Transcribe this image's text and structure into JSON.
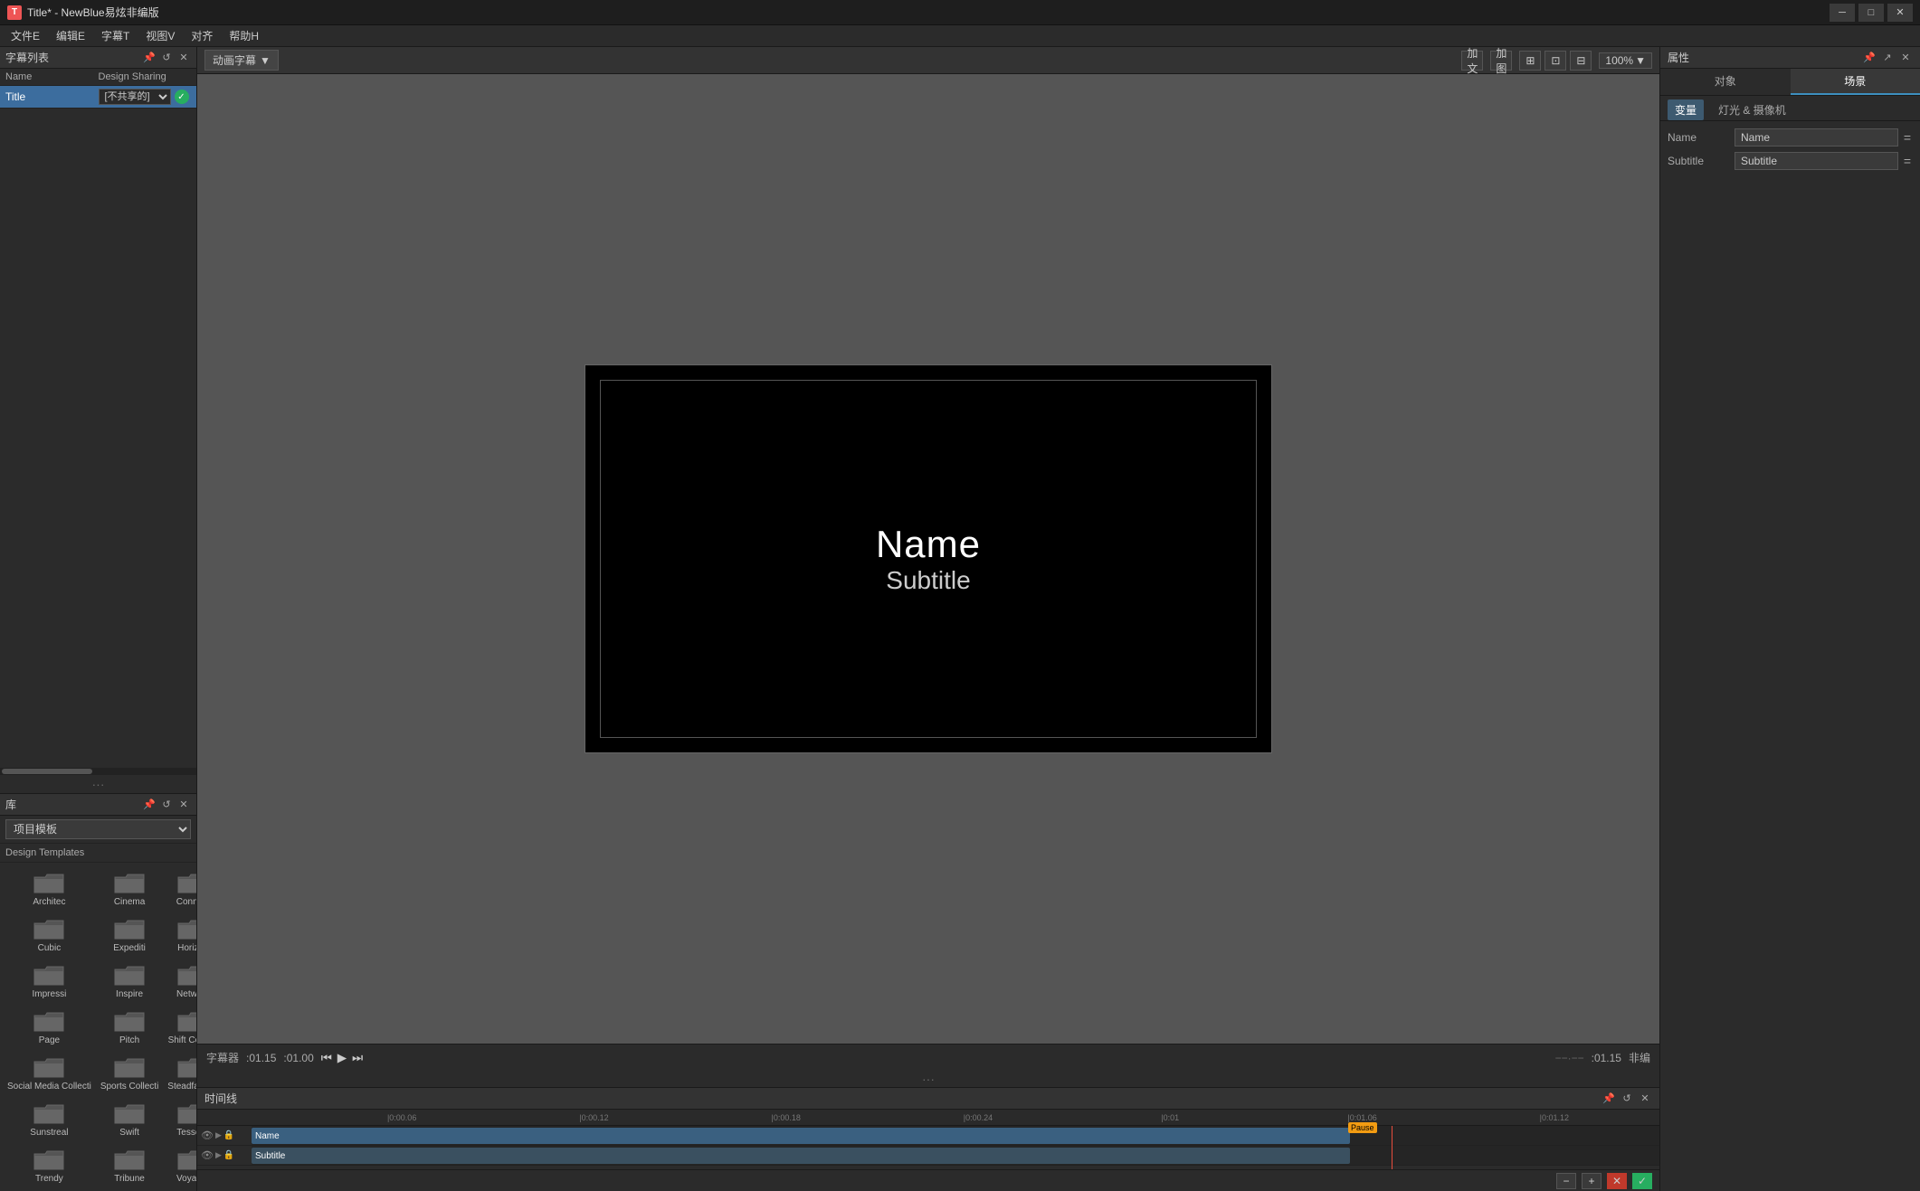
{
  "titleBar": {
    "title": "Title* - NewBlue易炫非编版",
    "appIcon": "T"
  },
  "menuBar": {
    "items": [
      "文件E",
      "编辑E",
      "字幕T",
      "视图V",
      "对齐",
      "帮助H"
    ]
  },
  "leftPanel": {
    "captionList": {
      "title": "字幕列表",
      "columnName": "Name",
      "columnSharing": "Design Sharing",
      "rows": [
        {
          "name": "Title",
          "sharing": "[不共享的]"
        }
      ]
    },
    "library": {
      "title": "库",
      "dropdownLabel": "项目模板",
      "templatesLabel": "Design Templates",
      "templates": [
        {
          "name": "Architec"
        },
        {
          "name": "Cinema"
        },
        {
          "name": "Connect"
        },
        {
          "name": "Cubic"
        },
        {
          "name": "Expediti"
        },
        {
          "name": "Horizon"
        },
        {
          "name": "Impressi"
        },
        {
          "name": "Inspire"
        },
        {
          "name": "Network"
        },
        {
          "name": "Page"
        },
        {
          "name": "Pitch"
        },
        {
          "name": "Shift Collecti"
        },
        {
          "name": "Social Media Collecti"
        },
        {
          "name": "Sports Collecti"
        },
        {
          "name": "Steadfas Vol"
        },
        {
          "name": "Sunstreal"
        },
        {
          "name": "Swift"
        },
        {
          "name": "Tessella"
        },
        {
          "name": "Trendy"
        },
        {
          "name": "Tribune"
        },
        {
          "name": "Voyager"
        }
      ]
    }
  },
  "preview": {
    "modeLabel": "动画字幕",
    "addTextLabel": "添加文字+",
    "addShapeLabel": "添加图形+",
    "zoomLabel": "100%",
    "titleText": "Name",
    "subtitleText": "Subtitle"
  },
  "captionControls": {
    "label": "字幕器",
    "startTime": ":01.15",
    "endTime": ":01.00",
    "playhead": ":01.15",
    "nonEditLabel": "非编"
  },
  "timeline": {
    "title": "时间线",
    "tracks": [
      {
        "name": "Name",
        "type": "name"
      },
      {
        "name": "Subtitle",
        "type": "subtitle"
      }
    ],
    "rulerMarks": [
      "!0:00.06",
      "!0:00.12",
      "!0:00.18",
      "!0:00.24",
      "!0:01",
      "!0:01.06",
      "!0:01.12"
    ],
    "pauseMarker": "Pause",
    "playheadTime": "0:01"
  },
  "rightPanel": {
    "title": "属性",
    "tabs": [
      {
        "label": "对象"
      },
      {
        "label": "场景"
      }
    ],
    "activeTab": "场景",
    "subtabs": [
      {
        "label": "变量"
      },
      {
        "label": "灯光 & 摄像机"
      }
    ],
    "activeSubtab": "变量",
    "properties": [
      {
        "label": "Name",
        "value": "Name"
      },
      {
        "label": "Subtitle",
        "value": "Subtitle"
      }
    ]
  }
}
